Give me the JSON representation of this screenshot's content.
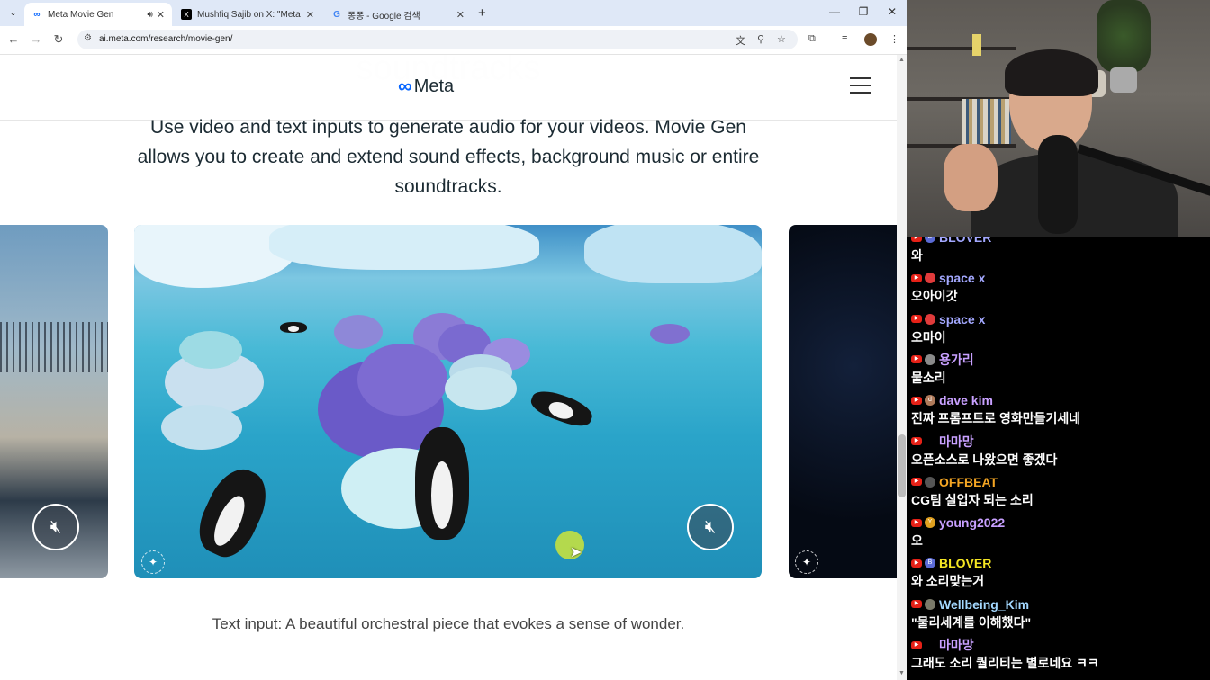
{
  "browser": {
    "tabs": [
      {
        "title": "Meta Movie Gen",
        "favicon": "meta-icon",
        "audio": true,
        "active": true
      },
      {
        "title": "Mushfiq Sajib on X: \"Meta is c",
        "favicon": "x-icon",
        "audio": false,
        "active": false
      },
      {
        "title": "퐁퐁 - Google 검색",
        "favicon": "google-icon",
        "audio": false,
        "active": false
      }
    ],
    "new_tab_label": "+",
    "url": "ai.meta.com/research/movie-gen/"
  },
  "page": {
    "ghost_heading": "soundtracks",
    "logo_text": "Meta",
    "description": "Use video and text inputs to generate audio for your videos. Movie Gen allows you to create and extend sound effects, background music or entire soundtracks.",
    "caption": "Text input: A beautiful orchestral piece that evokes a sense of wonder."
  },
  "chat": [
    {
      "user": "BLOVER",
      "text": "와",
      "color": "#a3a8ff",
      "avatar_color": "#5b6bd6",
      "avatar_letter": "B"
    },
    {
      "user": "space x",
      "text": "오아이갓",
      "color": "#a3a8ff",
      "avatar_color": "#e03b3b",
      "avatar_letter": ""
    },
    {
      "user": "space x",
      "text": "오마이",
      "color": "#a3a8ff",
      "avatar_color": "#e03b3b",
      "avatar_letter": ""
    },
    {
      "user": "용가리",
      "text": "물소리",
      "color": "#c8a0ff",
      "avatar_color": "#8a8a8a",
      "avatar_letter": ""
    },
    {
      "user": "dave kim",
      "text": "진짜 프롬프트로 영화만들기세네",
      "color": "#c8a0ff",
      "avatar_color": "#b07b5b",
      "avatar_letter": "d"
    },
    {
      "user": "마마망",
      "text": "오픈소스로 나왔으면 좋겠다",
      "color": "#c8a0ff",
      "avatar_color": "#000000",
      "avatar_letter": ""
    },
    {
      "user": "OFFBEAT",
      "text": "CG팀 실업자 되는 소리",
      "color": "#f5a623",
      "avatar_color": "#555555",
      "avatar_letter": ""
    },
    {
      "user": "young2022",
      "text": "오",
      "color": "#c8a0ff",
      "avatar_color": "#e0a020",
      "avatar_letter": "Y"
    },
    {
      "user": "BLOVER",
      "text": "와 소리맞는거",
      "color": "#f5e623",
      "avatar_color": "#5b6bd6",
      "avatar_letter": "B"
    },
    {
      "user": "Wellbeing_Kim",
      "text": "\"물리세계를 이해했다\"",
      "color": "#a3d8ff",
      "avatar_color": "#7a7a6a",
      "avatar_letter": ""
    },
    {
      "user": "마마망",
      "text": "그래도 소리 퀄리티는 별로네요 ㅋㅋ",
      "color": "#c8a0ff",
      "avatar_color": "#000000",
      "avatar_letter": ""
    }
  ]
}
